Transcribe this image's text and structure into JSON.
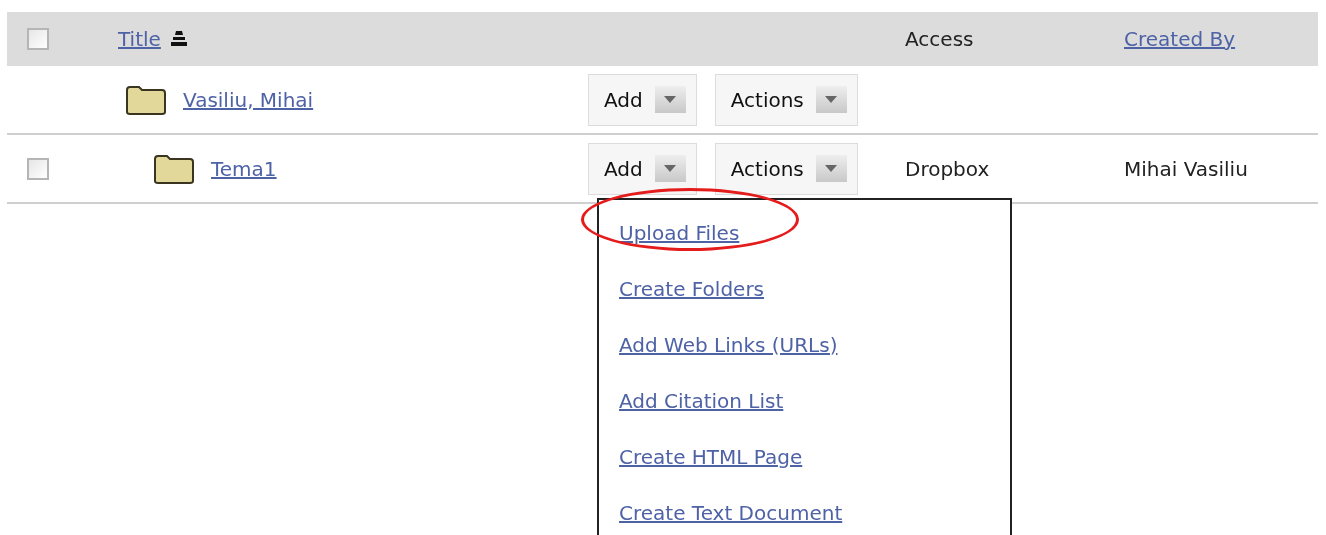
{
  "header": {
    "select_all_checked": false,
    "columns": [
      {
        "kind": "link",
        "label": "Title",
        "sorted": true
      },
      {
        "kind": "spacer"
      },
      {
        "kind": "text",
        "label": "Access"
      },
      {
        "kind": "link",
        "label": "Created By"
      }
    ]
  },
  "rows": [
    {
      "title": "Vasiliu, Mihai",
      "add_label": "Add",
      "actions_label": "Actions",
      "children": [
        {
          "title": "Tema1",
          "checked": false,
          "add_label": "Add",
          "actions_label": "Actions",
          "access": "Dropbox",
          "created_by": "Mihai Vasiliu",
          "menu": {
            "open": true,
            "items": [
              {
                "label": "Upload Files",
                "circled": true
              },
              {
                "label": "Create Folders",
                "circled": false
              },
              {
                "label": "Add Web Links (URLs)",
                "circled": false
              },
              {
                "label": "Add Citation List",
                "circled": false
              },
              {
                "label": "Create HTML Page",
                "circled": false
              },
              {
                "label": "Create Text Document",
                "circled": false
              }
            ]
          }
        }
      ]
    }
  ]
}
